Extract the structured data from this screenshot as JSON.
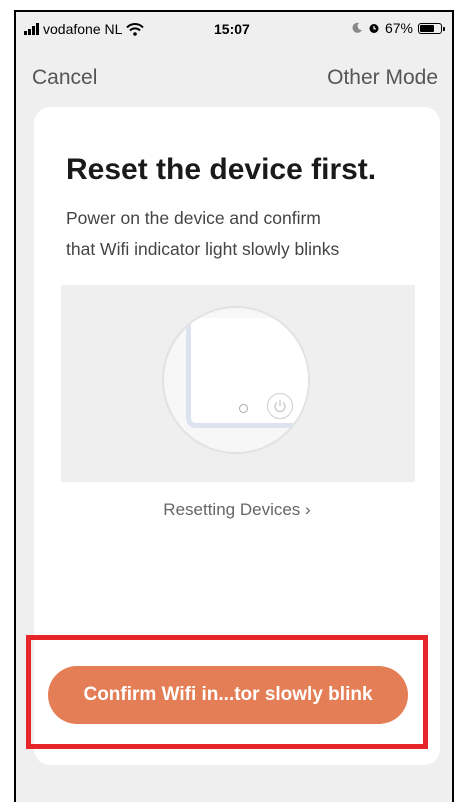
{
  "status_bar": {
    "carrier": "vodafone NL",
    "time": "15:07",
    "battery": "67%"
  },
  "nav": {
    "cancel_label": "Cancel",
    "other_mode_label": "Other Mode"
  },
  "card": {
    "title": "Reset the device first.",
    "description_line1": "Power on the device and confirm",
    "description_line2": "that Wifi indicator light slowly blinks",
    "reset_link": "Resetting Devices ›",
    "confirm_button": "Confirm Wifi in...tor slowly blink"
  },
  "colors": {
    "accent": "#e47e57",
    "highlight": "#e6262b"
  }
}
